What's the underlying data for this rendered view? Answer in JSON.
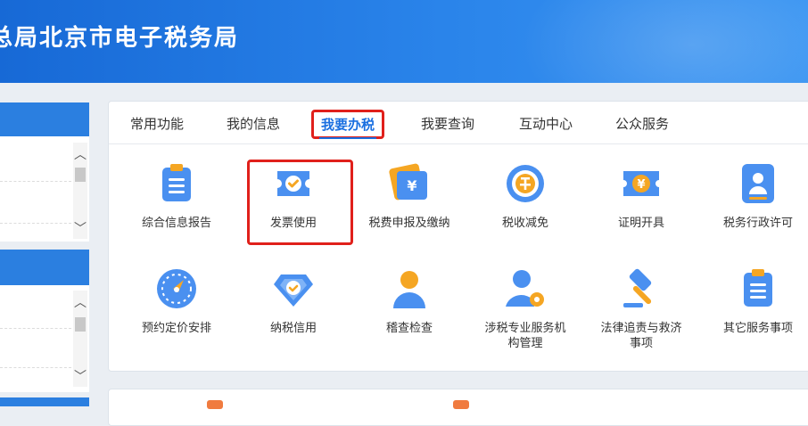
{
  "header": {
    "title": "总局北京市电子税务局"
  },
  "tabs": [
    {
      "label": "常用功能"
    },
    {
      "label": "我的信息"
    },
    {
      "label": "我要办税"
    },
    {
      "label": "我要查询"
    },
    {
      "label": "互动中心"
    },
    {
      "label": "公众服务"
    }
  ],
  "active_tab": "我要办税",
  "services": [
    {
      "label": "综合信息报告",
      "icon": "report-icon"
    },
    {
      "label": "发票使用",
      "icon": "invoice-ticket-icon"
    },
    {
      "label": "税费申报及缴纳",
      "icon": "tax-declaration-icon"
    },
    {
      "label": "税收减免",
      "icon": "tax-reduction-icon"
    },
    {
      "label": "证明开具",
      "icon": "certificate-icon"
    },
    {
      "label": "税务行政许可",
      "icon": "license-icon"
    },
    {
      "label": "预约定价安排",
      "icon": "compass-icon"
    },
    {
      "label": "纳税信用",
      "icon": "credit-diamond-icon"
    },
    {
      "label": "稽查检查",
      "icon": "inspector-icon"
    },
    {
      "label": "涉税专业服务机构管理",
      "label_line1": "涉税专业服务机",
      "label_line2": "构管理",
      "icon": "agent-gear-icon"
    },
    {
      "label": "法律追责与救济事项",
      "label_line1": "法律追责与救济",
      "label_line2": "事项",
      "icon": "gavel-icon"
    },
    {
      "label": "其它服务事项",
      "icon": "clipboard-icon"
    }
  ],
  "colors": {
    "header": "#1d72de",
    "accent": "#1a6fe0",
    "highlight": "#e0201b",
    "icon_blue": "#4a90f0",
    "icon_orange": "#f5a623"
  }
}
